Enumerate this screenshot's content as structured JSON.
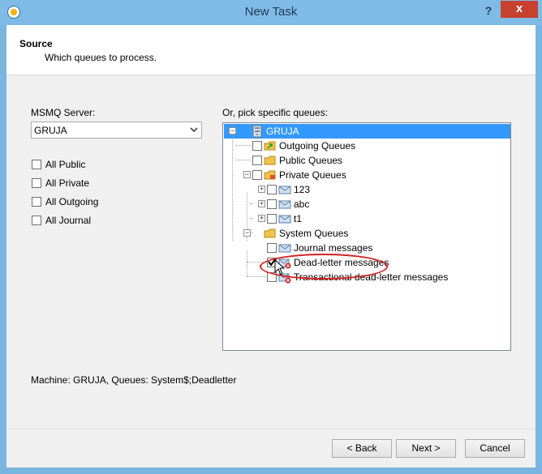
{
  "window": {
    "title": "New Task",
    "help_glyph": "?",
    "close_glyph": "x"
  },
  "header": {
    "title": "Source",
    "subtitle": "Which queues to process."
  },
  "left": {
    "server_label": "MSMQ Server:",
    "server_value": "GRUJA",
    "checkboxes": [
      {
        "label": "All Public",
        "checked": false
      },
      {
        "label": "All Private",
        "checked": false
      },
      {
        "label": "All Outgoing",
        "checked": false
      },
      {
        "label": "All Journal",
        "checked": false
      }
    ]
  },
  "right": {
    "label": "Or, pick specific queues:",
    "tree": [
      {
        "label": "GRUJA",
        "icon": "server-icon",
        "selected": true,
        "expanded": true
      },
      {
        "label": "Outgoing Queues",
        "icon": "outgoing-folder-icon"
      },
      {
        "label": "Public Queues",
        "icon": "folder-icon"
      },
      {
        "label": "Private Queues",
        "icon": "private-folder-icon",
        "expanded": true
      },
      {
        "label": "123",
        "icon": "queue-icon"
      },
      {
        "label": "abc",
        "icon": "queue-icon"
      },
      {
        "label": "t1",
        "icon": "queue-icon"
      },
      {
        "label": "System Queues",
        "icon": "folder-icon",
        "expanded": true
      },
      {
        "label": "Journal messages",
        "icon": "journal-queue-icon"
      },
      {
        "label": "Dead-letter messages",
        "icon": "deadletter-queue-icon",
        "checked": true
      },
      {
        "label": "Transactional dead-letter messages",
        "icon": "deadletter-queue-icon"
      }
    ]
  },
  "status": "Machine: GRUJA, Queues: System$;Deadletter",
  "buttons": {
    "back": "< Back",
    "next": "Next >",
    "cancel": "Cancel"
  },
  "colors": {
    "title_bar": "#7fbbe6",
    "close": "#c7412f",
    "selection": "#3399ff",
    "highlight": "#d42020"
  }
}
